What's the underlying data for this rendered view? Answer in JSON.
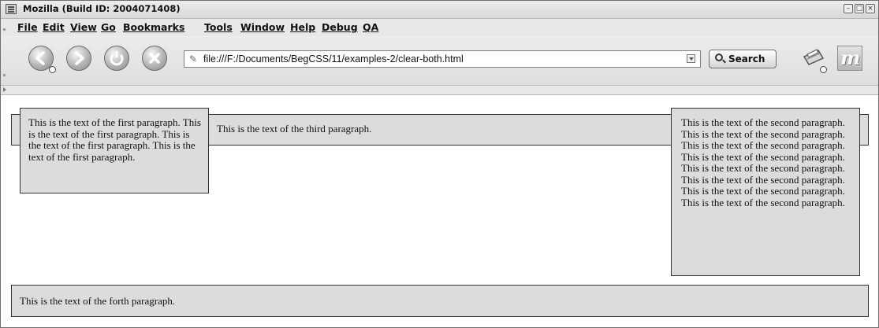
{
  "window": {
    "title": "Mozilla (Build ID: 2004071408)",
    "controls": [
      "minimize-icon",
      "maximize-icon",
      "close-icon"
    ]
  },
  "menu": {
    "items": [
      "File",
      "Edit",
      "View",
      "Go",
      "Bookmarks",
      "Tools",
      "Window",
      "Help",
      "Debug",
      "QA"
    ]
  },
  "navigation": {
    "buttons": [
      "back-icon",
      "forward-icon",
      "reload-icon",
      "stop-icon"
    ],
    "url": "file:///F:/Documents/BegCSS/11/examples-2/clear-both.html",
    "search_label": "Search",
    "print_icon": "print-icon",
    "logo_letter": "m"
  },
  "content": {
    "paragraph_first": "This is the text of the first paragraph. This is the text of the first paragraph. This is the text of the first paragraph. This is the text of the first paragraph.",
    "paragraph_second": "This is the text of the second paragraph. This is the text of the second paragraph. This is the text of the second paragraph. This is the text of the second paragraph. This is the text of the second paragraph. This is the text of the second paragraph. This is the text of the second paragraph. This is the text of the second paragraph.",
    "paragraph_third": "This is the text of the third paragraph.",
    "paragraph_forth": "This is the text of the forth paragraph."
  },
  "colors": {
    "paragraph_background": "#dcdcdc",
    "chrome_background": "#e8e8e8",
    "border": "#333333"
  }
}
